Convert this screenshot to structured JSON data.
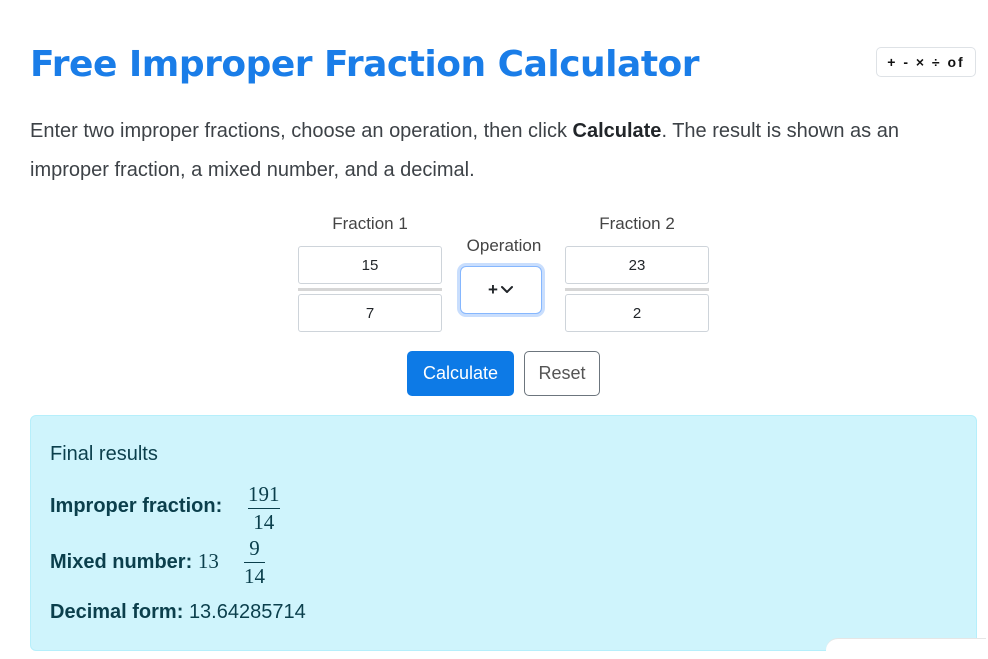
{
  "page": {
    "title": "Free Improper Fraction Calculator",
    "ops_badge": "+ - × ÷ of",
    "intro_part1": "Enter two improper fractions, choose an operation, then click ",
    "intro_bold": "Calculate",
    "intro_part2": ". The result is shown as an improper fraction, a mixed number, and a decimal."
  },
  "form": {
    "fraction1": {
      "label": "Fraction 1",
      "numerator": "15",
      "denominator": "7"
    },
    "operation": {
      "label": "Operation",
      "selected": "+"
    },
    "fraction2": {
      "label": "Fraction 2",
      "numerator": "23",
      "denominator": "2"
    },
    "calculate_label": "Calculate",
    "reset_label": "Reset"
  },
  "results": {
    "title": "Final results",
    "improper_label": "Improper fraction:",
    "improper_num": "191",
    "improper_den": "14",
    "mixed_label": "Mixed number:",
    "mixed_whole": "13",
    "mixed_num": "9",
    "mixed_den": "14",
    "decimal_label": "Decimal form:",
    "decimal_value": "13.64285714"
  },
  "colors": {
    "title": "#1a7de8",
    "primary_button": "#0d7ae6",
    "results_bg": "#cff4fc",
    "results_text": "#0b3f4c"
  },
  "icons": {
    "operation_dropdown": "chevron-down-icon"
  }
}
